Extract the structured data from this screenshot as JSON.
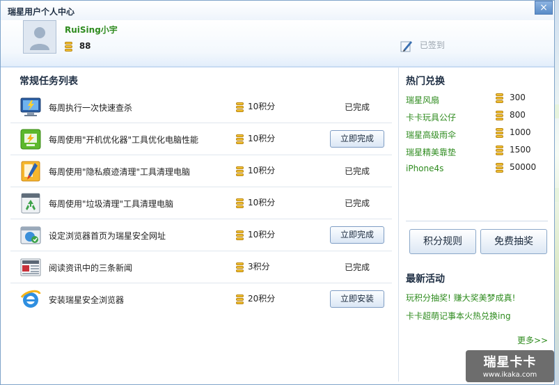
{
  "window": {
    "title": "瑞星用户个人中心",
    "close": "×"
  },
  "user": {
    "name": "RuiSing小宇",
    "points": "88",
    "sign_status": "已签到"
  },
  "tasks": {
    "title": "常规任务列表",
    "items": [
      {
        "name": "每周执行一次快速查杀",
        "points": "10积分",
        "status": "已完成",
        "icon": "monitor-scan-icon"
      },
      {
        "name": "每周使用\"开机优化器\"工具优化电脑性能",
        "points": "10积分",
        "action": "立即完成",
        "icon": "boot-optimizer-icon"
      },
      {
        "name": "每周使用\"隐私痕迹清理\"工具清理电脑",
        "points": "10积分",
        "status": "已完成",
        "icon": "privacy-clean-icon"
      },
      {
        "name": "每周使用\"垃圾清理\"工具清理电脑",
        "points": "10积分",
        "status": "已完成",
        "icon": "recycle-icon"
      },
      {
        "name": "设定浏览器首页为瑞星安全网址",
        "points": "10积分",
        "action": "立即完成",
        "icon": "browser-home-icon"
      },
      {
        "name": "阅读资讯中的三条新闻",
        "points": "3积分",
        "status": "已完成",
        "icon": "news-icon"
      },
      {
        "name": "安装瑞星安全浏览器",
        "points": "20积分",
        "action": "立即安装",
        "icon": "ie-browser-icon"
      }
    ]
  },
  "hot": {
    "title": "热门兑换",
    "items": [
      {
        "name": "瑞星风扇",
        "cost": "300"
      },
      {
        "name": "卡卡玩具公仔",
        "cost": "800"
      },
      {
        "name": "瑞星高级雨伞",
        "cost": "1000"
      },
      {
        "name": "瑞星精美靠垫",
        "cost": "1500"
      },
      {
        "name": "iPhone4s",
        "cost": "50000"
      }
    ],
    "rules_label": "积分规则",
    "lottery_label": "免费抽奖"
  },
  "activities": {
    "title": "最新活动",
    "items": [
      "玩积分抽奖! 赚大奖美梦成真!",
      "卡卡超萌记事本火热兑换ing"
    ],
    "more": "更多>>"
  },
  "watermark": {
    "line1": "瑞星卡卡",
    "line2": "www.ikaka.com"
  },
  "colors": {
    "accent_green": "#2e8b1e",
    "coin_gold": "#f2c233",
    "title_blue": "#1f2f44"
  }
}
